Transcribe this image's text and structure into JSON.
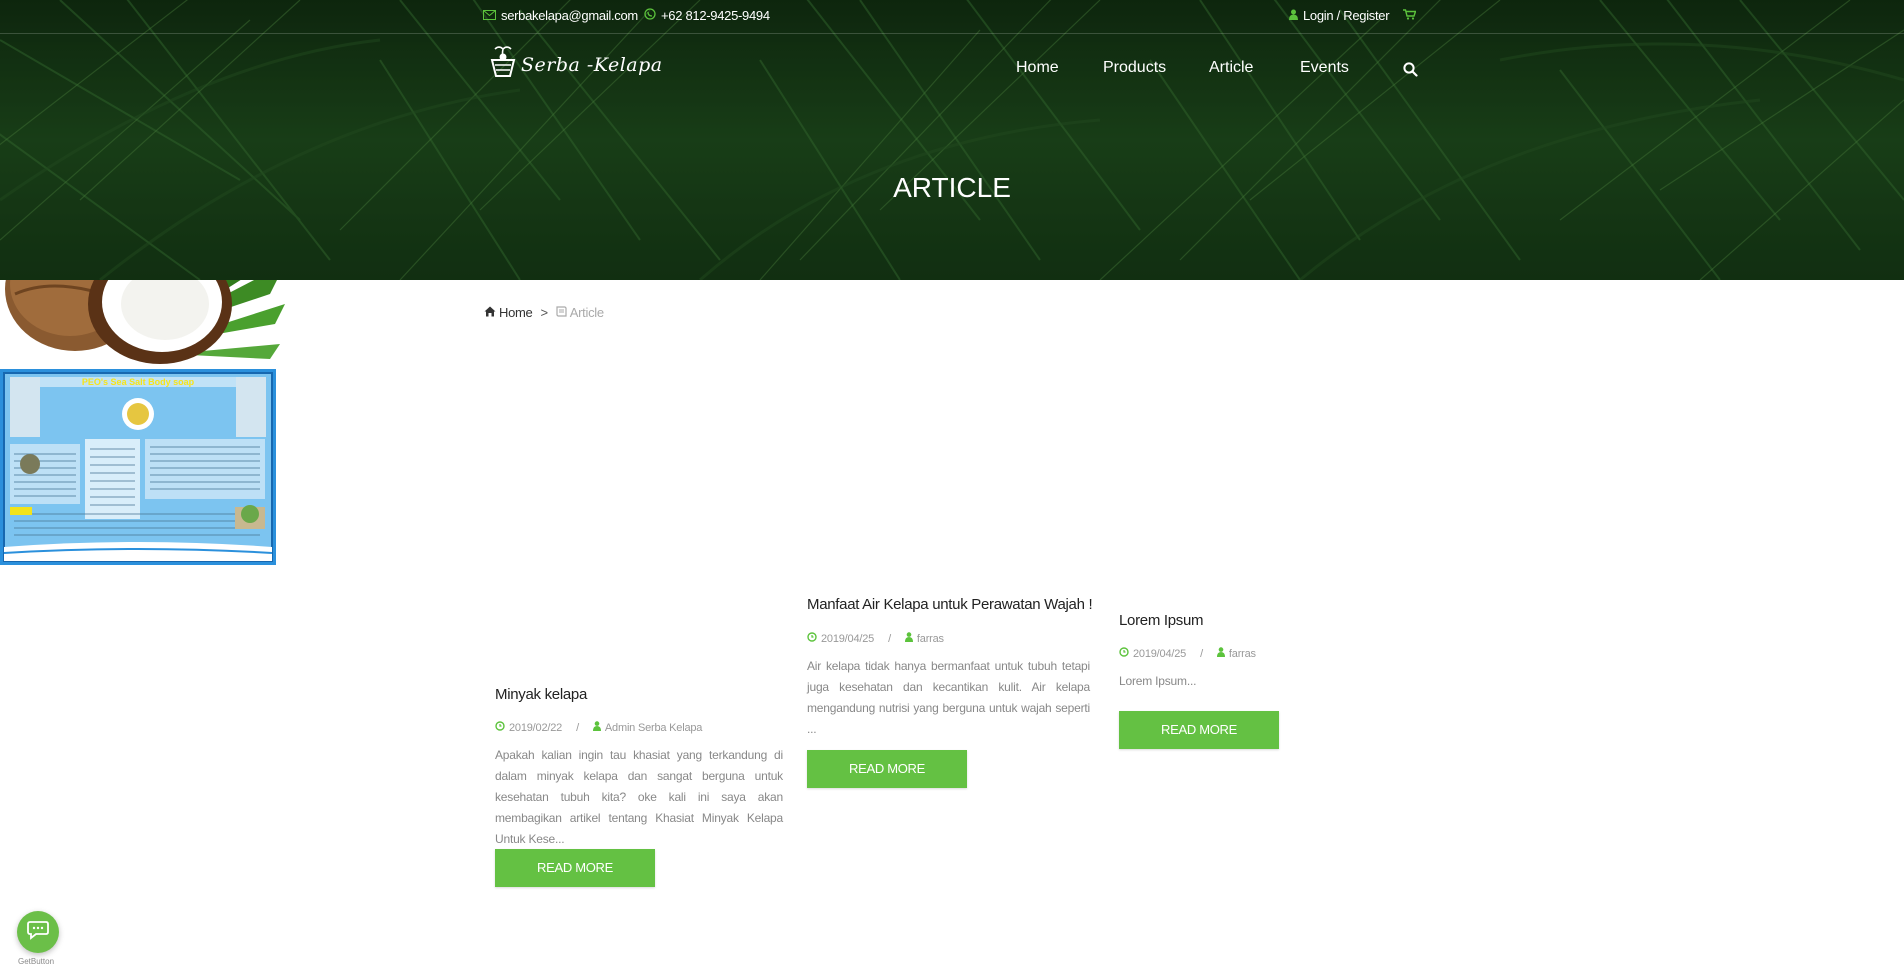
{
  "topbar": {
    "email": "serbakelapa@gmail.com",
    "phone": "+62 812-9425-9494",
    "login": "Login / Register",
    "icons": [
      "envelope-icon",
      "whatsapp-icon",
      "user-icon",
      "cart-icon"
    ]
  },
  "brand": {
    "name": "Serba -Kelapa"
  },
  "nav": {
    "items": [
      "Home",
      "Products",
      "Article",
      "Events"
    ],
    "search_icon": "search-icon"
  },
  "hero": {
    "title": "ARTICLE"
  },
  "breadcrumb": {
    "home": "Home",
    "separator": ">",
    "current": "Article"
  },
  "articles": [
    {
      "title": "Minyak kelapa",
      "date": "2019/02/22",
      "author": "Admin Serba Kelapa",
      "excerpt": "Apakah kalian ingin tau khasiat yang terkandung di dalam minyak kelapa dan sangat berguna untuk kesehatan tubuh kita? oke kali ini saya akan membagikan artikel tentang Khasiat Minyak Kelapa Untuk Kese...",
      "button": "READ MORE"
    },
    {
      "title": "Manfaat Air Kelapa untuk Perawatan Wajah !",
      "date": "2019/04/25",
      "author": "farras",
      "excerpt": "Air kelapa tidak hanya bermanfaat untuk tubuh tetapi juga kesehatan dan kecantikan kulit. Air kelapa mengandung nutrisi yang berguna untuk wajah seperti ...",
      "button": "READ MORE"
    },
    {
      "title": "Lorem Ipsum",
      "date": "2019/04/25",
      "author": "farras",
      "excerpt": "Lorem Ipsum...",
      "button": "READ MORE"
    }
  ],
  "flyer": {
    "heading": "PEO's Sea Salt Body soap"
  },
  "widget": {
    "label": "GetButton"
  },
  "colors": {
    "accent": "#64c143",
    "hero_dark": "#1d3d1b",
    "text": "#222222",
    "muted": "#999999"
  }
}
